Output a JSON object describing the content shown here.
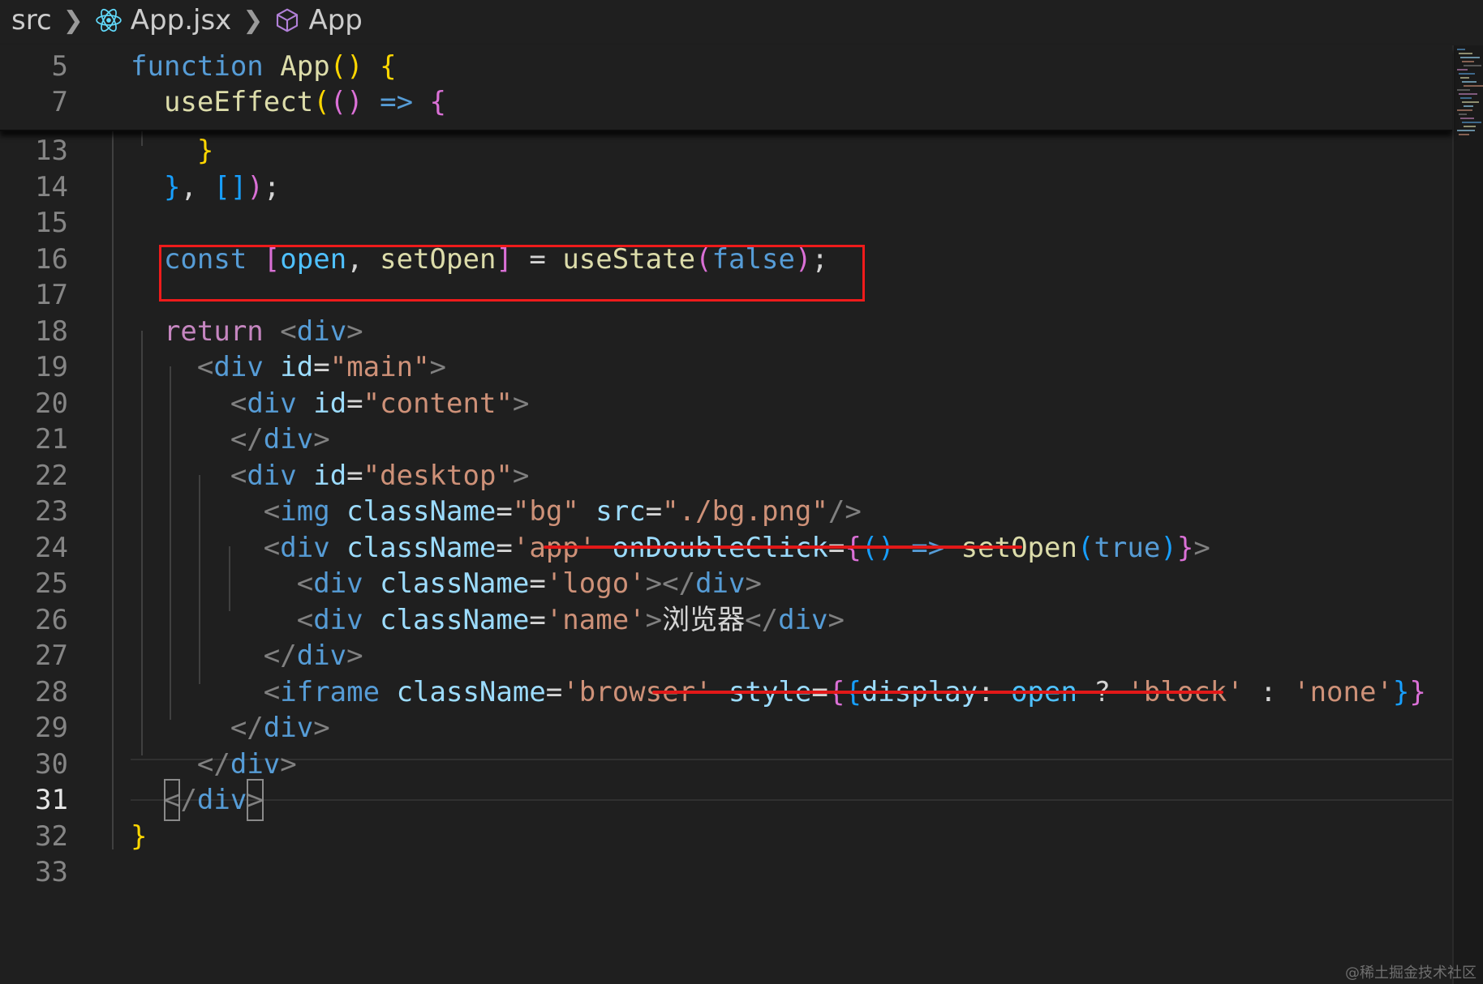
{
  "breadcrumb": {
    "folder": "src",
    "file": "App.jsx",
    "symbol": "App",
    "file_icon": "react-icon",
    "symbol_icon": "cube-icon"
  },
  "editor": {
    "active_line": 31,
    "sticky_lines": [
      {
        "number": "5",
        "tokens": [
          [
            "function",
            "#569cd6"
          ],
          [
            " ",
            "#d4d4d4"
          ],
          [
            "App",
            "#dcdcaa"
          ],
          [
            "()",
            "#ffd700"
          ],
          [
            " ",
            "#d4d4d4"
          ],
          [
            "{",
            "#ffd700"
          ]
        ]
      },
      {
        "number": "7",
        "tokens": [
          [
            "  ",
            "#d4d4d4"
          ],
          [
            "useEffect",
            "#dcdcaa"
          ],
          [
            "(",
            "#ffd700"
          ],
          [
            "()",
            "#da70d6"
          ],
          [
            " ",
            "#d4d4d4"
          ],
          [
            "=>",
            "#569cd6"
          ],
          [
            " ",
            "#d4d4d4"
          ],
          [
            "{",
            "#da70d6"
          ]
        ]
      }
    ],
    "lines": [
      {
        "number": "13",
        "tokens": [
          [
            "    ",
            "#d4d4d4"
          ],
          [
            "}",
            "#ffd700"
          ]
        ]
      },
      {
        "number": "14",
        "tokens": [
          [
            "  ",
            "#d4d4d4"
          ],
          [
            "}",
            "#179fff"
          ],
          [
            ", ",
            "#d4d4d4"
          ],
          [
            "[]",
            "#179fff"
          ],
          [
            ")",
            "#da70d6"
          ],
          [
            ";",
            "#d4d4d4"
          ]
        ]
      },
      {
        "number": "15",
        "tokens": []
      },
      {
        "number": "16",
        "tokens": [
          [
            "  ",
            "#d4d4d4"
          ],
          [
            "const",
            "#569cd6"
          ],
          [
            " ",
            "#d4d4d4"
          ],
          [
            "[",
            "#da70d6"
          ],
          [
            "open",
            "#4fc1ff"
          ],
          [
            ", ",
            "#d4d4d4"
          ],
          [
            "setOpen",
            "#dcdcaa"
          ],
          [
            "]",
            "#da70d6"
          ],
          [
            " = ",
            "#d4d4d4"
          ],
          [
            "useState",
            "#dcdcaa"
          ],
          [
            "(",
            "#da70d6"
          ],
          [
            "false",
            "#569cd6"
          ],
          [
            ")",
            "#da70d6"
          ],
          [
            ";",
            "#d4d4d4"
          ]
        ]
      },
      {
        "number": "17",
        "tokens": []
      },
      {
        "number": "18",
        "tokens": [
          [
            "  ",
            "#d4d4d4"
          ],
          [
            "return",
            "#c586c0"
          ],
          [
            " ",
            "#d4d4d4"
          ],
          [
            "<",
            "#808080"
          ],
          [
            "div",
            "#569cd6"
          ],
          [
            ">",
            "#808080"
          ]
        ]
      },
      {
        "number": "19",
        "tokens": [
          [
            "    ",
            "#d4d4d4"
          ],
          [
            "<",
            "#808080"
          ],
          [
            "div",
            "#569cd6"
          ],
          [
            " ",
            "#d4d4d4"
          ],
          [
            "id",
            "#9cdcfe"
          ],
          [
            "=",
            "#d4d4d4"
          ],
          [
            "\"main\"",
            "#ce9178"
          ],
          [
            ">",
            "#808080"
          ]
        ]
      },
      {
        "number": "20",
        "tokens": [
          [
            "      ",
            "#d4d4d4"
          ],
          [
            "<",
            "#808080"
          ],
          [
            "div",
            "#569cd6"
          ],
          [
            " ",
            "#d4d4d4"
          ],
          [
            "id",
            "#9cdcfe"
          ],
          [
            "=",
            "#d4d4d4"
          ],
          [
            "\"content\"",
            "#ce9178"
          ],
          [
            ">",
            "#808080"
          ]
        ]
      },
      {
        "number": "21",
        "tokens": [
          [
            "      ",
            "#d4d4d4"
          ],
          [
            "</",
            "#808080"
          ],
          [
            "div",
            "#569cd6"
          ],
          [
            ">",
            "#808080"
          ]
        ]
      },
      {
        "number": "22",
        "tokens": [
          [
            "      ",
            "#d4d4d4"
          ],
          [
            "<",
            "#808080"
          ],
          [
            "div",
            "#569cd6"
          ],
          [
            " ",
            "#d4d4d4"
          ],
          [
            "id",
            "#9cdcfe"
          ],
          [
            "=",
            "#d4d4d4"
          ],
          [
            "\"desktop\"",
            "#ce9178"
          ],
          [
            ">",
            "#808080"
          ]
        ]
      },
      {
        "number": "23",
        "tokens": [
          [
            "        ",
            "#d4d4d4"
          ],
          [
            "<",
            "#808080"
          ],
          [
            "img",
            "#569cd6"
          ],
          [
            " ",
            "#d4d4d4"
          ],
          [
            "className",
            "#9cdcfe"
          ],
          [
            "=",
            "#d4d4d4"
          ],
          [
            "\"bg\"",
            "#ce9178"
          ],
          [
            " ",
            "#d4d4d4"
          ],
          [
            "src",
            "#9cdcfe"
          ],
          [
            "=",
            "#d4d4d4"
          ],
          [
            "\"./bg.png\"",
            "#ce9178"
          ],
          [
            "/>",
            "#808080"
          ]
        ]
      },
      {
        "number": "24",
        "tokens": [
          [
            "        ",
            "#d4d4d4"
          ],
          [
            "<",
            "#808080"
          ],
          [
            "div",
            "#569cd6"
          ],
          [
            " ",
            "#d4d4d4"
          ],
          [
            "className",
            "#9cdcfe"
          ],
          [
            "=",
            "#d4d4d4"
          ],
          [
            "'app'",
            "#ce9178"
          ],
          [
            " ",
            "#d4d4d4"
          ],
          [
            "onDoubleClick",
            "#9cdcfe"
          ],
          [
            "=",
            "#d4d4d4"
          ],
          [
            "{",
            "#da70d6"
          ],
          [
            "()",
            "#179fff"
          ],
          [
            " ",
            "#d4d4d4"
          ],
          [
            "=>",
            "#569cd6"
          ],
          [
            " ",
            "#d4d4d4"
          ],
          [
            "setOpen",
            "#dcdcaa"
          ],
          [
            "(",
            "#179fff"
          ],
          [
            "true",
            "#569cd6"
          ],
          [
            ")",
            "#179fff"
          ],
          [
            "}",
            "#da70d6"
          ],
          [
            ">",
            "#808080"
          ]
        ]
      },
      {
        "number": "25",
        "tokens": [
          [
            "          ",
            "#d4d4d4"
          ],
          [
            "<",
            "#808080"
          ],
          [
            "div",
            "#569cd6"
          ],
          [
            " ",
            "#d4d4d4"
          ],
          [
            "className",
            "#9cdcfe"
          ],
          [
            "=",
            "#d4d4d4"
          ],
          [
            "'logo'",
            "#ce9178"
          ],
          [
            "></",
            "#808080"
          ],
          [
            "div",
            "#569cd6"
          ],
          [
            ">",
            "#808080"
          ]
        ]
      },
      {
        "number": "26",
        "tokens": [
          [
            "          ",
            "#d4d4d4"
          ],
          [
            "<",
            "#808080"
          ],
          [
            "div",
            "#569cd6"
          ],
          [
            " ",
            "#d4d4d4"
          ],
          [
            "className",
            "#9cdcfe"
          ],
          [
            "=",
            "#d4d4d4"
          ],
          [
            "'name'",
            "#ce9178"
          ],
          [
            ">",
            "#808080"
          ],
          [
            "浏览器",
            "#d4d4d4"
          ],
          [
            "</",
            "#808080"
          ],
          [
            "div",
            "#569cd6"
          ],
          [
            ">",
            "#808080"
          ]
        ]
      },
      {
        "number": "27",
        "tokens": [
          [
            "        ",
            "#d4d4d4"
          ],
          [
            "</",
            "#808080"
          ],
          [
            "div",
            "#569cd6"
          ],
          [
            ">",
            "#808080"
          ]
        ]
      },
      {
        "number": "28",
        "tokens": [
          [
            "        ",
            "#d4d4d4"
          ],
          [
            "<",
            "#808080"
          ],
          [
            "iframe",
            "#569cd6"
          ],
          [
            " ",
            "#d4d4d4"
          ],
          [
            "className",
            "#9cdcfe"
          ],
          [
            "=",
            "#d4d4d4"
          ],
          [
            "'browser'",
            "#ce9178"
          ],
          [
            " ",
            "#d4d4d4"
          ],
          [
            "style",
            "#9cdcfe"
          ],
          [
            "=",
            "#d4d4d4"
          ],
          [
            "{",
            "#da70d6"
          ],
          [
            "{",
            "#179fff"
          ],
          [
            "display",
            "#9cdcfe"
          ],
          [
            ": ",
            "#d4d4d4"
          ],
          [
            "open",
            "#4fc1ff"
          ],
          [
            " ? ",
            "#d4d4d4"
          ],
          [
            "'block'",
            "#ce9178"
          ],
          [
            " : ",
            "#d4d4d4"
          ],
          [
            "'none'",
            "#ce9178"
          ],
          [
            "}",
            "#179fff"
          ],
          [
            "}",
            "#da70d6"
          ]
        ]
      },
      {
        "number": "29",
        "tokens": [
          [
            "      ",
            "#d4d4d4"
          ],
          [
            "</",
            "#808080"
          ],
          [
            "div",
            "#569cd6"
          ],
          [
            ">",
            "#808080"
          ]
        ]
      },
      {
        "number": "30",
        "tokens": [
          [
            "    ",
            "#d4d4d4"
          ],
          [
            "</",
            "#808080"
          ],
          [
            "div",
            "#569cd6"
          ],
          [
            ">",
            "#808080"
          ]
        ]
      },
      {
        "number": "31",
        "tokens": [
          [
            "  ",
            "#d4d4d4"
          ],
          [
            "<",
            "#808080",
            "bracket-match"
          ],
          [
            "/",
            "#808080"
          ],
          [
            "div",
            "#569cd6"
          ],
          [
            ">",
            "#808080",
            "bracket-match"
          ]
        ]
      },
      {
        "number": "32",
        "tokens": [
          [
            "}",
            "#ffd700"
          ]
        ]
      },
      {
        "number": "33",
        "tokens": []
      }
    ]
  },
  "annotations": {
    "box_color": "#ef1b1b",
    "underline_color": "#e21818",
    "highlighted_lines": [
      "16"
    ],
    "underlined_lines": [
      "24",
      "28"
    ]
  },
  "watermark": "@稀土掘金技术社区"
}
